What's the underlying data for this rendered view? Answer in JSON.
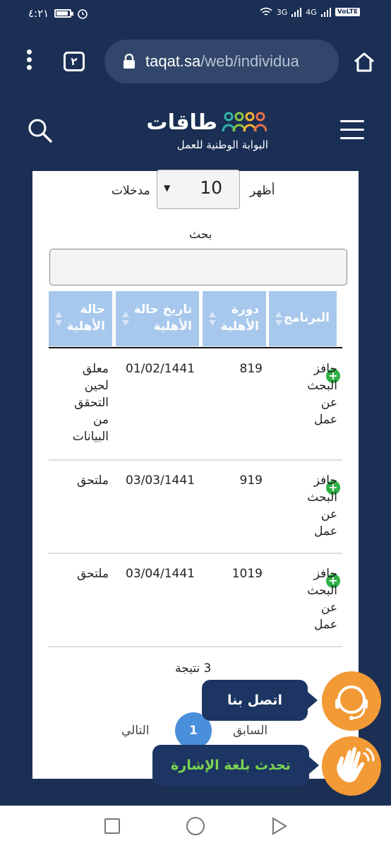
{
  "status_bar": {
    "time": "٤:٢١",
    "network_3g": "3G",
    "network_4g": "4G",
    "volte": "VoLTE"
  },
  "browser": {
    "tab_count": "٢",
    "url_host": "taqat.sa",
    "url_path": "/web/individua"
  },
  "site": {
    "logo_word": "طاقات",
    "logo_sub": "البوابة الوطنية للعمل"
  },
  "table_controls": {
    "show_label": "أظهر",
    "page_size": "10",
    "entries_label": "مدخلات",
    "search_label": "بحث",
    "search_value": ""
  },
  "table": {
    "headers": [
      {
        "line1": "البرنامج",
        "line2": ""
      },
      {
        "line1": "دورة",
        "line2": "الأهلية"
      },
      {
        "line1": "تاريخ حالة",
        "line2": "الأهلية"
      },
      {
        "line1": "حالة",
        "line2": "الأهلية"
      }
    ],
    "rows": [
      {
        "program": [
          "حافز",
          "البحث",
          "عن",
          "عمل"
        ],
        "cycle": "819",
        "date": "01/02/1441",
        "status": [
          "معلق",
          "لحين",
          "التحقق",
          "من",
          "البيانات"
        ]
      },
      {
        "program": [
          "حافز",
          "البحث",
          "عن",
          "عمل"
        ],
        "cycle": "919",
        "date": "03/03/1441",
        "status": [
          "ملتحق"
        ]
      },
      {
        "program": [
          "حافز",
          "البحث",
          "عن",
          "عمل"
        ],
        "cycle": "1019",
        "date": "03/04/1441",
        "status": [
          "ملتحق"
        ]
      }
    ]
  },
  "pagination": {
    "result_count": "3 نتيجة",
    "prev_label": "السابق",
    "current_page": "1",
    "next_label": "التالي"
  },
  "help": {
    "contact_label": "اتصل بنا",
    "sign_language_label": "تحدث بلغة الإشارة"
  },
  "colors": {
    "header_bg": "#1b2f55",
    "table_header": "#a7c8ec",
    "accent_orange": "#f29a36",
    "pill_bg": "#1c3562",
    "pill_green": "#7bd44f",
    "page_blue": "#4a8fdb",
    "expand_green": "#2eaf45"
  }
}
